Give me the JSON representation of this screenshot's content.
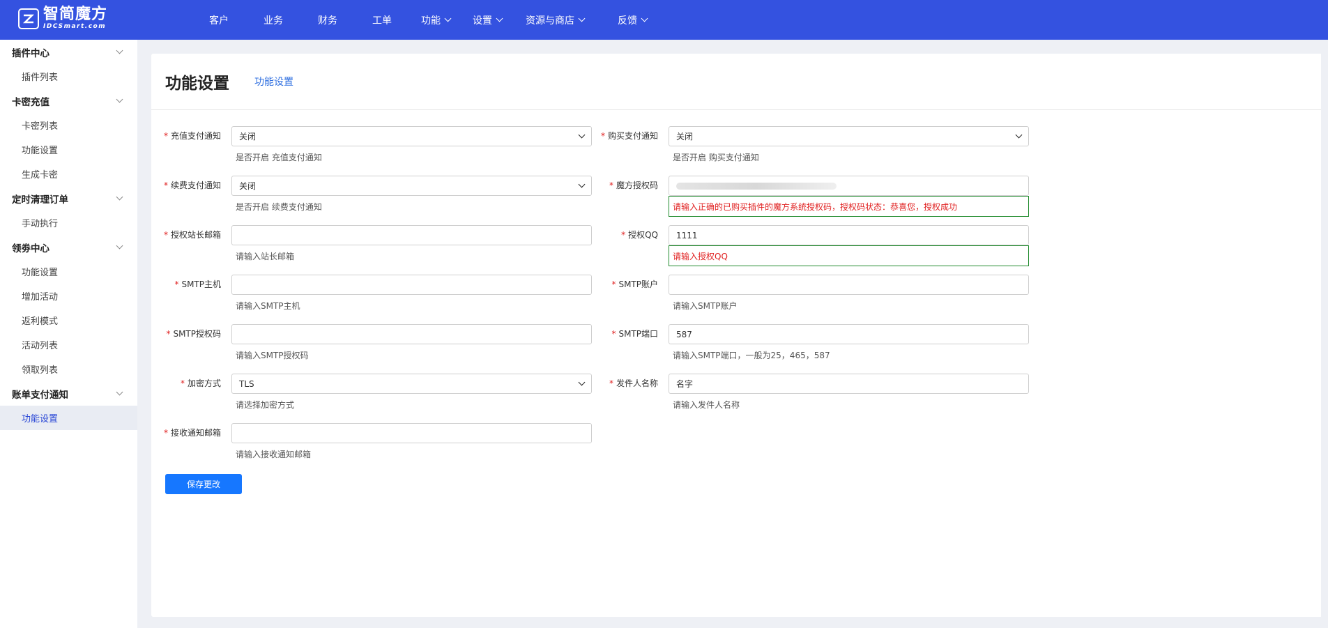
{
  "brand": {
    "name_cn": "智简魔方",
    "name_en": "IDCSmart.com"
  },
  "nav": [
    {
      "label": "客户",
      "has_menu": false
    },
    {
      "label": "业务",
      "has_menu": false
    },
    {
      "label": "财务",
      "has_menu": false
    },
    {
      "label": "工单",
      "has_menu": false
    },
    {
      "label": "功能",
      "has_menu": true
    },
    {
      "label": "设置",
      "has_menu": true
    },
    {
      "label": "资源与商店",
      "has_menu": true
    },
    {
      "label": "反馈",
      "has_menu": true
    }
  ],
  "sidebar": {
    "groups": [
      {
        "label": "插件中心",
        "items": [
          "插件列表"
        ]
      },
      {
        "label": "卡密充值",
        "items": [
          "卡密列表",
          "功能设置",
          "生成卡密"
        ]
      },
      {
        "label": "定时清理订单",
        "items": [
          "手动执行"
        ]
      },
      {
        "label": "领劵中心",
        "items": [
          "功能设置",
          "增加活动",
          "返利模式",
          "活动列表",
          "领取列表"
        ]
      },
      {
        "label": "账单支付通知",
        "items": [
          "功能设置"
        ]
      }
    ],
    "active": "账单支付通知/功能设置"
  },
  "page": {
    "title": "功能设置",
    "tab": "功能设置"
  },
  "form": {
    "recharge_notify": {
      "label": "充值支付通知",
      "value": "关闭",
      "hint": "是否开启 充值支付通知"
    },
    "purchase_notify": {
      "label": "购买支付通知",
      "value": "关闭",
      "hint": "是否开启 购买支付通知"
    },
    "renew_notify": {
      "label": "续费支付通知",
      "value": "关闭",
      "hint": "是否开启 续费支付通知"
    },
    "license_code": {
      "label": "魔方授权码",
      "value": "",
      "error": "请输入正确的已购买插件的魔方系统授权码，授权码状态：恭喜您，授权成功"
    },
    "owner_email": {
      "label": "授权站长邮箱",
      "value": "",
      "hint": "请输入站长邮箱"
    },
    "license_qq": {
      "label": "授权QQ",
      "value": "1111",
      "error": "请输入授权QQ"
    },
    "smtp_host": {
      "label": "SMTP主机",
      "value": "",
      "hint": "请输入SMTP主机"
    },
    "smtp_account": {
      "label": "SMTP账户",
      "value": "",
      "hint": "请输入SMTP账户"
    },
    "smtp_password": {
      "label": "SMTP授权码",
      "value": "",
      "hint": "请输入SMTP授权码"
    },
    "smtp_port": {
      "label": "SMTP端口",
      "value": "587",
      "hint": "请输入SMTP端口，一般为25，465，587"
    },
    "encryption": {
      "label": "加密方式",
      "value": "TLS",
      "hint": "请选择加密方式"
    },
    "sender_name": {
      "label": "发件人名称",
      "value": "名字",
      "hint": "请输入发件人名称"
    },
    "receive_email": {
      "label": "接收通知邮箱",
      "value": "",
      "hint": "请输入接收通知邮箱"
    },
    "required_mark": "*",
    "save_label": "保存更改"
  },
  "colors": {
    "topbar": "#3452e0",
    "primary_button": "#1677ff",
    "error_text": "#e02020",
    "error_border": "#1f8a2c"
  }
}
